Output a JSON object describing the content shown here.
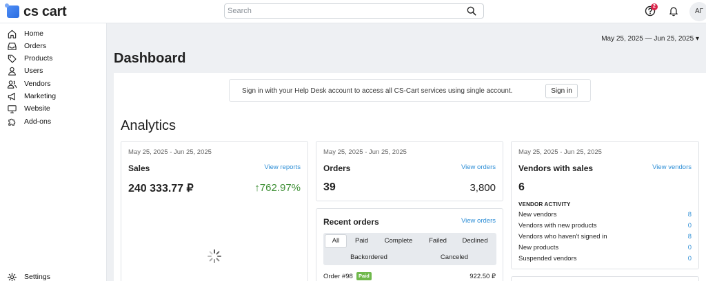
{
  "brand": {
    "logo_text": "cs cart",
    "accent": "#2d8ed6",
    "growth_color": "#3e8f35",
    "badge_color": "#d9254a"
  },
  "header": {
    "search_placeholder": "Search",
    "help_badge": "2",
    "avatar_initials": "АГ"
  },
  "sidebar": {
    "items": [
      {
        "label": "Home",
        "icon": "home-icon"
      },
      {
        "label": "Orders",
        "icon": "inbox-icon"
      },
      {
        "label": "Products",
        "icon": "tag-icon"
      },
      {
        "label": "Users",
        "icon": "user-icon"
      },
      {
        "label": "Vendors",
        "icon": "users-icon"
      },
      {
        "label": "Marketing",
        "icon": "megaphone-icon"
      },
      {
        "label": "Website",
        "icon": "monitor-icon"
      },
      {
        "label": "Add-ons",
        "icon": "puzzle-icon"
      }
    ],
    "settings": {
      "label": "Settings",
      "icon": "gear-icon"
    }
  },
  "main": {
    "date_range": "May 25, 2025 — Jun 25, 2025",
    "title": "Dashboard",
    "helpdesk": {
      "text": "Sign in with your Help Desk account to access all CS-Cart services using single account.",
      "button": "Sign in"
    },
    "analytics_title": "Analytics",
    "sales": {
      "date": "May 25, 2025 - Jun 25, 2025",
      "title": "Sales",
      "link": "View reports",
      "value": "240 333.77 ₽",
      "growth": "↑762.97%"
    },
    "orders": {
      "date": "May 25, 2025 - Jun 25, 2025",
      "title": "Orders",
      "link": "View orders",
      "count": "39",
      "total": "3,800"
    },
    "vendors": {
      "date": "May 25, 2025 - Jun 25, 2025",
      "title": "Vendors with sales",
      "link": "View vendors",
      "count": "6",
      "activity_title": "VENDOR ACTIVITY",
      "rows": [
        {
          "label": "New vendors",
          "count": "8"
        },
        {
          "label": "Vendors with new products",
          "count": "0"
        },
        {
          "label": "Vendors who haven't signed in",
          "count": "8"
        },
        {
          "label": "New products",
          "count": "0"
        },
        {
          "label": "Suspended vendors",
          "count": "0"
        }
      ]
    },
    "recent_orders": {
      "title": "Recent orders",
      "link": "View orders",
      "tabs": [
        "All",
        "Paid",
        "Complete",
        "Failed",
        "Declined",
        "Backordered",
        "Canceled"
      ],
      "first_order": {
        "number": "Order #98",
        "status": "Paid",
        "amount": "922.50 ₽"
      }
    }
  }
}
